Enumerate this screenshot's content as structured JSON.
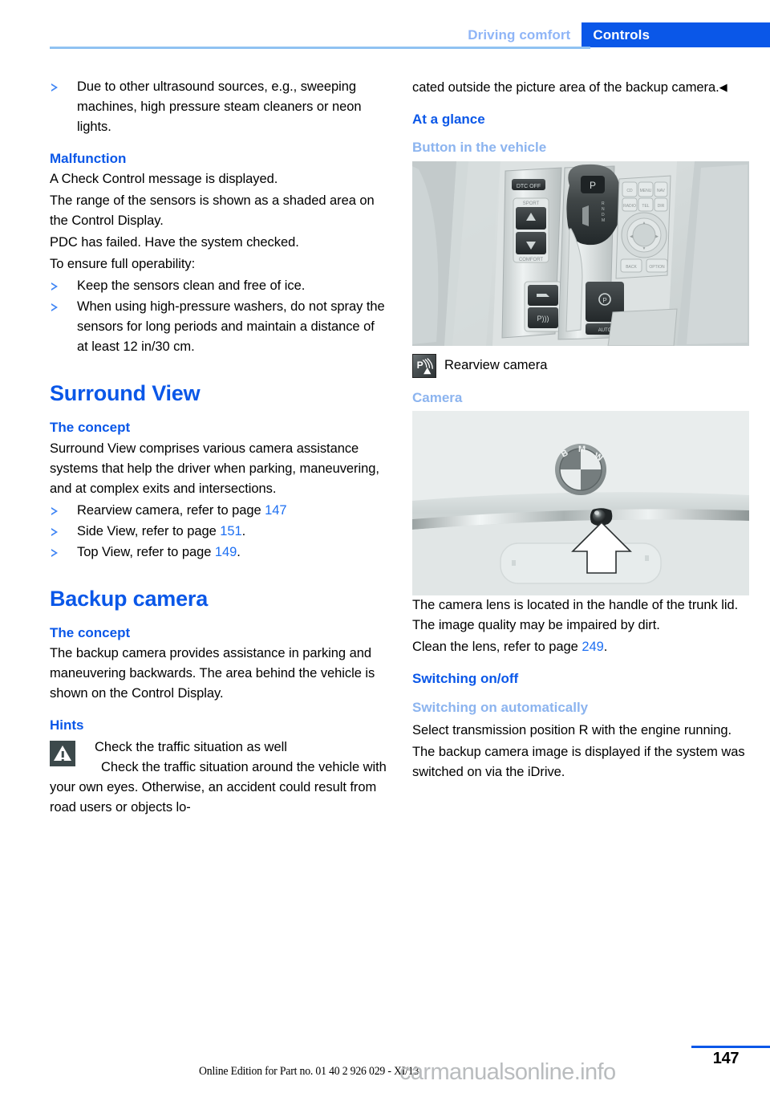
{
  "header": {
    "tab_inactive": "Driving comfort",
    "tab_active": "Controls"
  },
  "left_column": {
    "bullet_intro": "Due to other ultrasound sources, e.g., sweeping machines, high pressure steam cleaners or neon lights.",
    "malfunction_heading": "Malfunction",
    "malfunction_p1": "A Check Control message is displayed.",
    "malfunction_p2": "The range of the sensors is shown as a shaded area on the Control Display.",
    "malfunction_p3": "PDC has failed. Have the system checked.",
    "malfunction_p4": "To ensure full operability:",
    "malfunction_bullet1": "Keep the sensors clean and free of ice.",
    "malfunction_bullet2": "When using high-pressure washers, do not spray the sensors for long periods and maintain a distance of at least 12 in/30 cm.",
    "surround_view_heading": "Surround View",
    "surround_concept_heading": "The concept",
    "surround_concept_p": "Surround View comprises various camera assistance systems that help the driver when parking, maneuvering, and at complex exits and intersections.",
    "surround_bullet1_text": "Rearview camera, refer to page ",
    "surround_bullet1_ref": "147",
    "surround_bullet2_text": "Side View, refer to page ",
    "surround_bullet2_ref": "151",
    "surround_bullet2_tail": ".",
    "surround_bullet3_text": "Top View, refer to page ",
    "surround_bullet3_ref": "149",
    "surround_bullet3_tail": ".",
    "backup_camera_heading": "Backup camera",
    "backup_concept_heading": "The concept",
    "backup_concept_p": "The backup camera provides assistance in parking and maneuvering backwards. The area behind the vehicle is shown on the Control Display.",
    "hints_heading": "Hints",
    "warning_title": "Check the traffic situation as well",
    "warning_body": "Check the traffic situation around the vehicle with your own eyes. Otherwise, an accident could result from road users or objects lo-"
  },
  "right_column": {
    "continued_text": "cated outside the picture area of the backup camera.",
    "continued_endmark": "◀",
    "at_a_glance_heading": "At a glance",
    "button_in_vehicle_heading": "Button in the vehicle",
    "console_figure_alt": "BMW center console with gear selector, driving experience switch and iDrive controller",
    "rearview_caption": "Rearview camera",
    "rearview_icon_name": "pdc-rearview-camera-icon",
    "camera_heading": "Camera",
    "trunk_figure_alt": "BMW trunk lid with roundel badge and camera lens in the handle, white arrow pointing at the lens",
    "camera_p1": "The camera lens is located in the handle of the trunk lid. The image quality may be impaired by dirt.",
    "camera_p2_text": "Clean the lens, refer to page ",
    "camera_p2_ref": "249",
    "camera_p2_tail": ".",
    "switching_heading": "Switching on/off",
    "switching_auto_heading": "Switching on automatically",
    "switching_auto_p1": "Select transmission position R with the engine running.",
    "switching_auto_p2": "The backup camera image is displayed if the system was switched on via the iDrive."
  },
  "footer": {
    "page_number": "147",
    "edition": "Online Edition for Part no. 01 40 2 926 029 - XI/13",
    "watermark": "carmanualsonline.info"
  },
  "colors": {
    "accent_blue": "#0a57e8",
    "light_blue": "#8cb4ef",
    "ref_blue": "#1d6ff2",
    "rule_blue": "#8fc2f2",
    "warn_gray": "#3c494b"
  }
}
